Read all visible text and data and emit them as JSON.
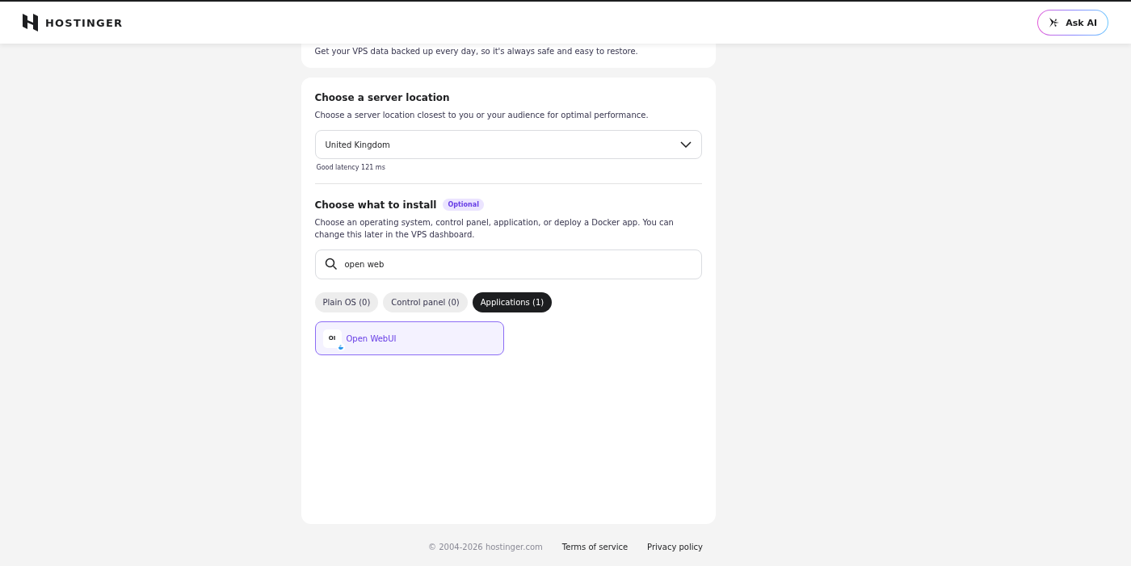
{
  "header": {
    "brand": "HOSTINGER",
    "ask_ai": "Ask AI"
  },
  "backup_card": {
    "description": "Get your VPS data backed up every day, so it's always safe and easy to restore."
  },
  "location": {
    "title": "Choose a server location",
    "description": "Choose a server location closest to you or your audience for optimal performance.",
    "value": "United Kingdom",
    "hint": "Good latency 121 ms"
  },
  "install": {
    "title": "Choose what to install",
    "badge": "Optional",
    "description": "Choose an operating system, control panel, application, or deploy a Docker app. You can change this later in the VPS dashboard.",
    "search": {
      "value": "open web"
    },
    "filters": [
      {
        "label": "Plain OS (0)",
        "selected": false
      },
      {
        "label": "Control panel (0)",
        "selected": false
      },
      {
        "label": "Applications (1)",
        "selected": true
      }
    ],
    "results": [
      {
        "logo_text": "OI",
        "name": "Open WebUI",
        "selected": true
      }
    ]
  },
  "footer": {
    "copyright": "© 2004-2026 hostinger.com",
    "links": [
      "Terms of service",
      "Privacy policy"
    ]
  }
}
